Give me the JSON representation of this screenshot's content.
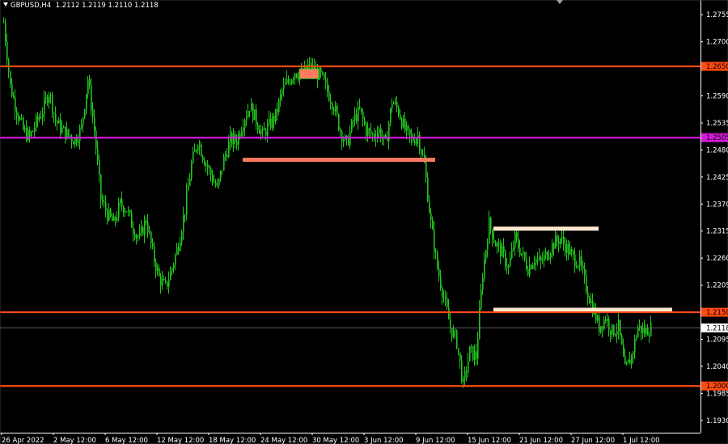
{
  "header": {
    "symbol": "GBPUSD,H4",
    "ohlc": "1.2112 1.2119 1.2110 1.2118"
  },
  "colors": {
    "background": "#000000",
    "axis": "#ffffff",
    "candle": "#22c51e",
    "level_orange": "#ff4a12",
    "level_magenta": "#d21ad8",
    "zone_salmon": "#ff7a60",
    "zone_cream": "#ffe8d0",
    "price_line": "#7a7a7a"
  },
  "chart_data": {
    "type": "line",
    "title": "",
    "xlabel": "",
    "ylabel": "",
    "ylim": [
      1.1905,
      1.2785
    ],
    "y_ticks": [
      "1.2755",
      "1.2700",
      "1.2650",
      "1.2590",
      "1.2535",
      "1.2480",
      "1.2425",
      "1.2370",
      "1.2315",
      "1.2260",
      "1.2205",
      "1.2150",
      "1.2095",
      "1.2040",
      "1.1985",
      "1.1930"
    ],
    "y_ticks_hidden": [
      "1.2650",
      "1.2150"
    ],
    "x_ticks": [
      "26 Apr 2022",
      "2 May 12:00",
      "6 May 12:00",
      "12 May 12:00",
      "18 May 12:00",
      "24 May 12:00",
      "30 May 12:00",
      "3 Jun 12:00",
      "9 Jun 12:00",
      "15 Jun 12:00",
      "21 Jun 12:00",
      "27 Jun 12:00",
      "1 Jul 12:00"
    ],
    "series": [
      {
        "x": [
          0,
          8,
          16,
          24,
          32,
          40,
          48,
          56,
          64,
          72,
          80,
          88,
          96,
          104,
          112,
          120,
          128,
          136,
          144,
          152,
          160,
          168,
          176,
          184,
          192,
          200,
          208,
          216,
          224,
          232,
          240,
          248,
          256,
          264,
          272,
          280,
          288,
          296,
          304,
          312,
          320,
          328,
          336,
          344,
          352,
          360,
          368,
          376,
          384,
          392,
          400,
          408,
          416,
          424,
          432,
          440,
          448,
          456,
          464,
          472,
          480,
          488,
          496,
          504,
          512,
          520,
          528,
          536,
          544,
          552,
          560,
          568,
          576,
          584,
          592,
          600,
          608,
          616,
          624,
          632,
          640,
          648,
          656,
          664,
          672,
          680,
          688,
          696,
          704,
          712,
          720,
          728,
          736,
          744,
          752,
          760,
          768,
          776,
          784,
          792,
          800
        ],
        "values": [
          1.274,
          1.261,
          1.256,
          1.252,
          1.2505,
          1.2535,
          1.256,
          1.26,
          1.254,
          1.252,
          1.251,
          1.25,
          1.2525,
          1.2625,
          1.252,
          1.238,
          1.235,
          1.233,
          1.237,
          1.236,
          1.232,
          1.23,
          1.234,
          1.227,
          1.222,
          1.22,
          1.224,
          1.229,
          1.236,
          1.245,
          1.25,
          1.246,
          1.243,
          1.24,
          1.246,
          1.25,
          1.25,
          1.254,
          1.257,
          1.254,
          1.251,
          1.253,
          1.255,
          1.26,
          1.262,
          1.264,
          1.263,
          1.265,
          1.264,
          1.263,
          1.26,
          1.257,
          1.252,
          1.249,
          1.254,
          1.256,
          1.252,
          1.251,
          1.252,
          1.249,
          1.258,
          1.256,
          1.252,
          1.25,
          1.251,
          1.245,
          1.233,
          1.224,
          1.218,
          1.212,
          1.209,
          1.2,
          1.207,
          1.206,
          1.223,
          1.233,
          1.229,
          1.227,
          1.224,
          1.23,
          1.227,
          1.224,
          1.226,
          1.225,
          1.227,
          1.229,
          1.23,
          1.228,
          1.226,
          1.225,
          1.22,
          1.216,
          1.212,
          1.214,
          1.211,
          1.212,
          1.203,
          1.206,
          1.212,
          1.211,
          1.2118
        ]
      }
    ],
    "levels": [
      {
        "price": 1.265,
        "label": "1.2650",
        "kind": "orange"
      },
      {
        "price": 1.2505,
        "label": "1.2505",
        "kind": "magenta"
      },
      {
        "price": 1.215,
        "label": "1.2150",
        "kind": "orange"
      },
      {
        "price": 1.2,
        "label": "1.2000",
        "kind": "orange"
      }
    ],
    "current_price": {
      "price": 1.2118,
      "label": "1.2118"
    },
    "zones": [
      {
        "price": 1.246,
        "x_start": 296,
        "x_end": 534,
        "kind": "salmon"
      },
      {
        "price": 1.232,
        "x_start": 606,
        "x_end": 736,
        "kind": "cream"
      },
      {
        "price": 1.2155,
        "x_start": 606,
        "x_end": 827,
        "kind": "cream"
      }
    ],
    "box": {
      "y_top": 1.2645,
      "y_bottom": 1.2625,
      "x_start": 366,
      "x_end": 390
    },
    "grid": false
  }
}
